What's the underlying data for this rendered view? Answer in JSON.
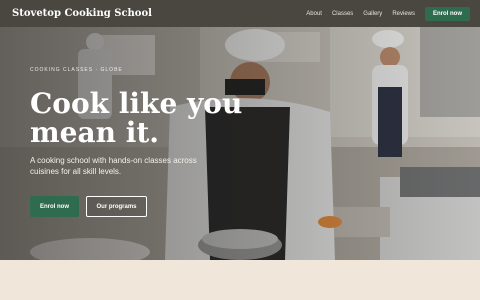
{
  "header": {
    "brand": "Stovetop Cooking School",
    "nav": [
      "About",
      "Classes",
      "Gallery",
      "Reviews"
    ],
    "cta": "Enrol now"
  },
  "hero": {
    "eyebrow": "COOKING CLASSES · GLOBE",
    "headline": "Cook like you mean it.",
    "subtext": "A cooking school with hands-on classes across cuisines for all skill levels.",
    "primary_cta": "Enrol now",
    "secondary_cta": "Our programs"
  },
  "colors": {
    "header_bg": "#4a4640",
    "accent": "#2f6b4f",
    "page_bg": "#f1e6da"
  }
}
